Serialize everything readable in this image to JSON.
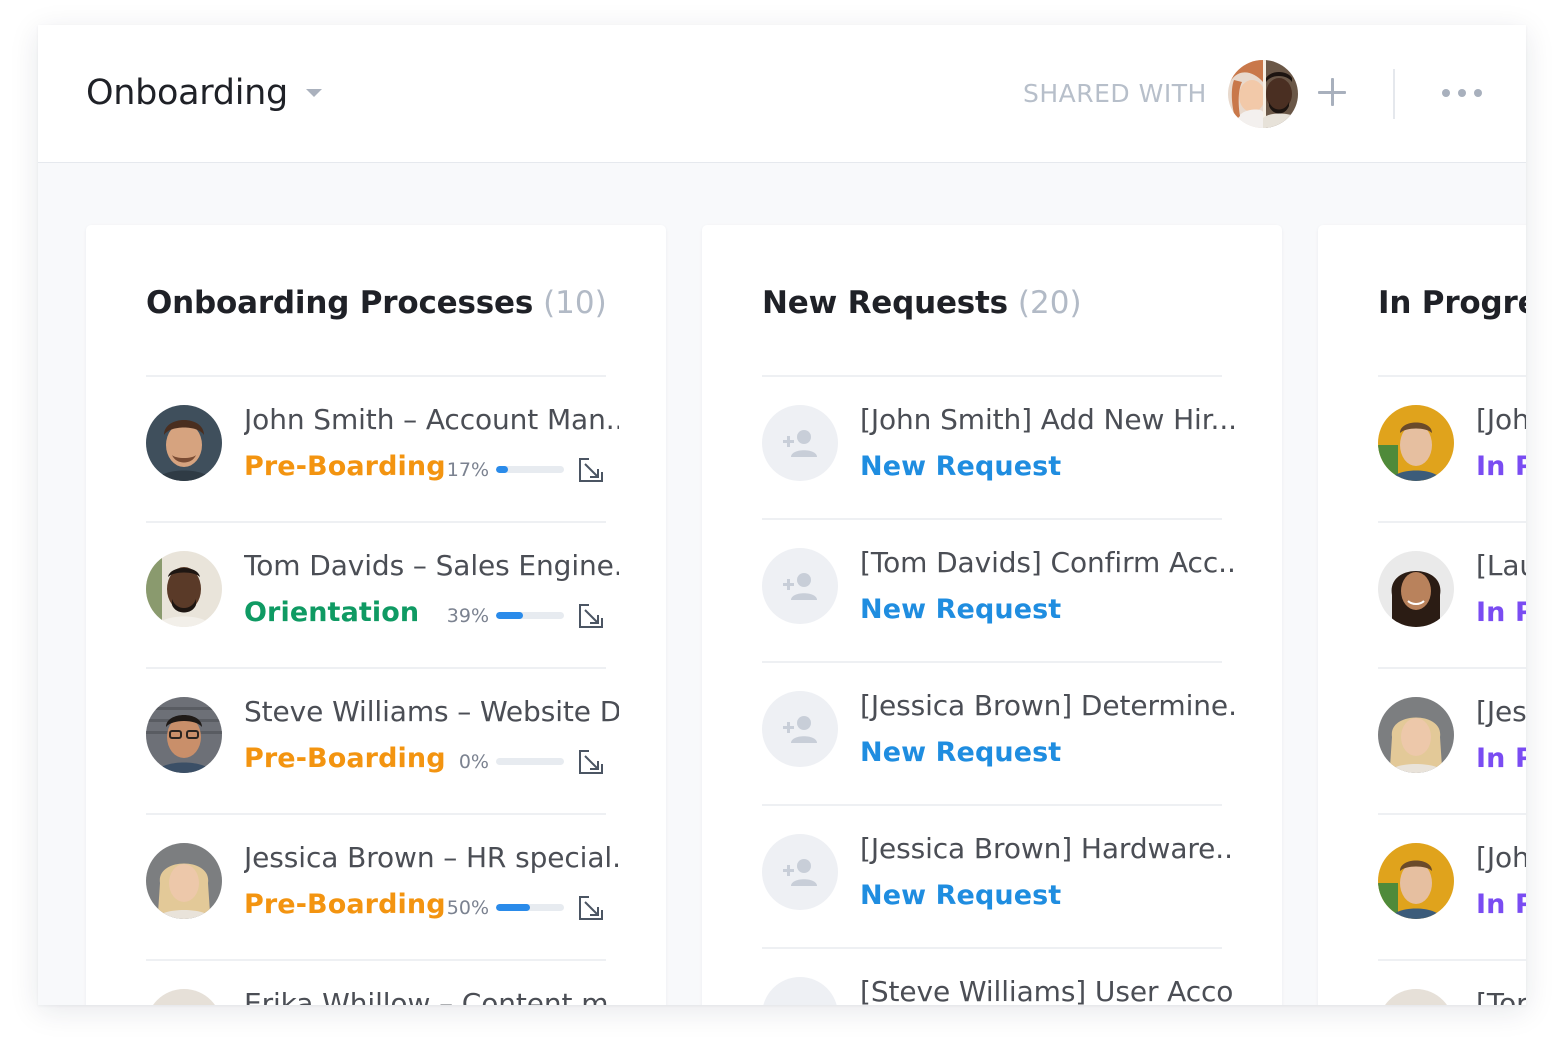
{
  "header": {
    "title": "Onboarding",
    "shared_label": "SHARED WITH"
  },
  "columns": [
    {
      "title": "Onboarding Processes",
      "count": "(10)",
      "items": [
        {
          "title": "John Smith – Account Man...",
          "status": "Pre-Boarding",
          "status_color": "#f39410",
          "progress_pct": 17,
          "progress_label": "17%"
        },
        {
          "title": "Tom Davids – Sales Engine...",
          "status": "Orientation",
          "status_color": "#0f9a63",
          "progress_pct": 39,
          "progress_label": "39%"
        },
        {
          "title": "Steve Williams – Website D...",
          "status": "Pre-Boarding",
          "status_color": "#f39410",
          "progress_pct": 0,
          "progress_label": "0%"
        },
        {
          "title": "Jessica Brown – HR special...",
          "status": "Pre-Boarding",
          "status_color": "#f39410",
          "progress_pct": 50,
          "progress_label": "50%"
        },
        {
          "title": "Erika Whillow – Content m..."
        }
      ]
    },
    {
      "title": "New Requests",
      "count": "(20)",
      "items": [
        {
          "title": "[John Smith] Add New Hir...",
          "status": "New Request"
        },
        {
          "title": "[Tom Davids] Confirm Acc...",
          "status": "New Request"
        },
        {
          "title": "[Jessica Brown] Determine...",
          "status": "New Request"
        },
        {
          "title": "[Jessica Brown] Hardware...",
          "status": "New Request"
        },
        {
          "title": "[Steve Williams] User Acco..."
        }
      ]
    },
    {
      "title": "In Progres",
      "items": [
        {
          "title": "[Joh",
          "status": "In Pr"
        },
        {
          "title": "[Lau",
          "status": "In Pr"
        },
        {
          "title": "[Jess",
          "status": "In Pr"
        },
        {
          "title": "[Joh",
          "status": "In Pr"
        },
        {
          "title": "[Tor"
        }
      ]
    }
  ],
  "colors": {
    "pre_boarding": "#f39410",
    "orientation": "#0f9a63",
    "new_request": "#1f8de0",
    "in_progress": "#7a4cf2",
    "progress_fill": "#2a8bea"
  },
  "icons": [
    "chevron-down-icon",
    "add-icon",
    "more-icon",
    "open-card-icon",
    "add-user-icon"
  ]
}
